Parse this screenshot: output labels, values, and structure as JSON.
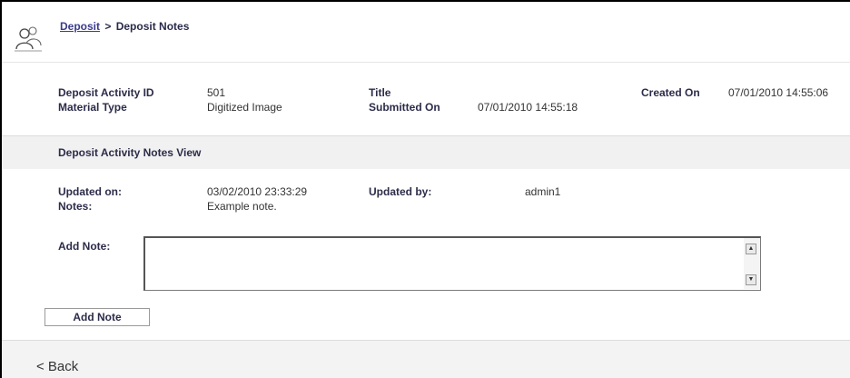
{
  "header": {
    "breadcrumb_link": "Deposit",
    "breadcrumb_sep": ">",
    "breadcrumb_current": "Deposit Notes",
    "icon": "users-icon"
  },
  "deposit_info": {
    "activity_id_label": "Deposit Activity ID",
    "activity_id_value": "501",
    "title_label": "Title",
    "title_value": "",
    "created_on_label": "Created On",
    "created_on_value": "07/01/2010 14:55:06",
    "material_type_label": "Material Type",
    "material_type_value": "Digitized Image",
    "submitted_on_label": "Submitted On",
    "submitted_on_value": "07/01/2010 14:55:18"
  },
  "notes_section": {
    "title": "Deposit Activity Notes View",
    "updated_on_label": "Updated on:",
    "updated_on_value": "03/02/2010 23:33:29",
    "updated_by_label": "Updated by:",
    "updated_by_value": "admin1",
    "notes_label": "Notes:",
    "notes_value": "Example note.",
    "add_note_label": "Add Note:",
    "add_note_value": "",
    "add_note_button": "Add Note"
  },
  "footer": {
    "back_label": "< Back"
  },
  "colors": {
    "label": "#2c2c4a",
    "link": "#3b3b8c",
    "section_bg": "#f1f1f1"
  }
}
